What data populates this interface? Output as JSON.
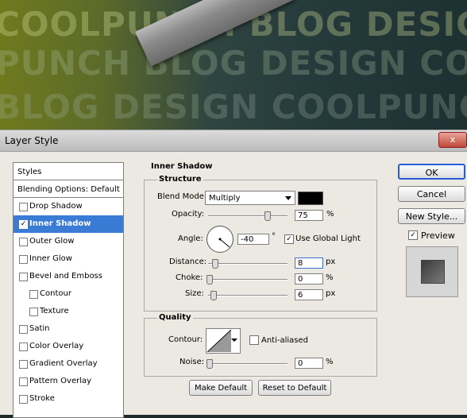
{
  "background": {
    "lines": [
      "COOLPUNCH BLOG DESIG",
      "PUNCH BLOG DESIGN CO",
      "BLOG DESIGN COOLPUNCH"
    ]
  },
  "dialog": {
    "title": "Layer Style",
    "close_label": "x"
  },
  "styles_panel": {
    "header": "Styles",
    "blending_options": "Blending Options: Default",
    "items": [
      {
        "label": "Drop Shadow",
        "checked": false,
        "sub": false
      },
      {
        "label": "Inner Shadow",
        "checked": true,
        "sub": false
      },
      {
        "label": "Outer Glow",
        "checked": false,
        "sub": false
      },
      {
        "label": "Inner Glow",
        "checked": false,
        "sub": false
      },
      {
        "label": "Bevel and Emboss",
        "checked": false,
        "sub": false
      },
      {
        "label": "Contour",
        "checked": false,
        "sub": true
      },
      {
        "label": "Texture",
        "checked": false,
        "sub": true
      },
      {
        "label": "Satin",
        "checked": false,
        "sub": false
      },
      {
        "label": "Color Overlay",
        "checked": false,
        "sub": false
      },
      {
        "label": "Gradient Overlay",
        "checked": false,
        "sub": false
      },
      {
        "label": "Pattern Overlay",
        "checked": false,
        "sub": false
      },
      {
        "label": "Stroke",
        "checked": false,
        "sub": false
      }
    ],
    "selected_index": 1
  },
  "inner_shadow": {
    "section_title": "Inner Shadow",
    "structure_title": "Structure",
    "blend_mode_label": "Blend Mode:",
    "blend_mode_value": "Multiply",
    "shadow_color": "#000000",
    "opacity_label": "Opacity:",
    "opacity_value": "75",
    "opacity_unit": "%",
    "angle_label": "Angle:",
    "angle_value": "-40",
    "angle_unit": "°",
    "use_global_light_label": "Use Global Light",
    "use_global_light": true,
    "distance_label": "Distance:",
    "distance_value": "8",
    "distance_unit": "px",
    "choke_label": "Choke:",
    "choke_value": "0",
    "choke_unit": "%",
    "size_label": "Size:",
    "size_value": "6",
    "size_unit": "px",
    "quality_title": "Quality",
    "contour_label": "Contour:",
    "anti_aliased_label": "Anti-aliased",
    "anti_aliased": false,
    "noise_label": "Noise:",
    "noise_value": "0",
    "noise_unit": "%",
    "make_default_label": "Make Default",
    "reset_default_label": "Reset to Default"
  },
  "buttons": {
    "ok": "OK",
    "cancel": "Cancel",
    "new_style": "New Style...",
    "preview_label": "Preview",
    "preview_checked": true
  }
}
